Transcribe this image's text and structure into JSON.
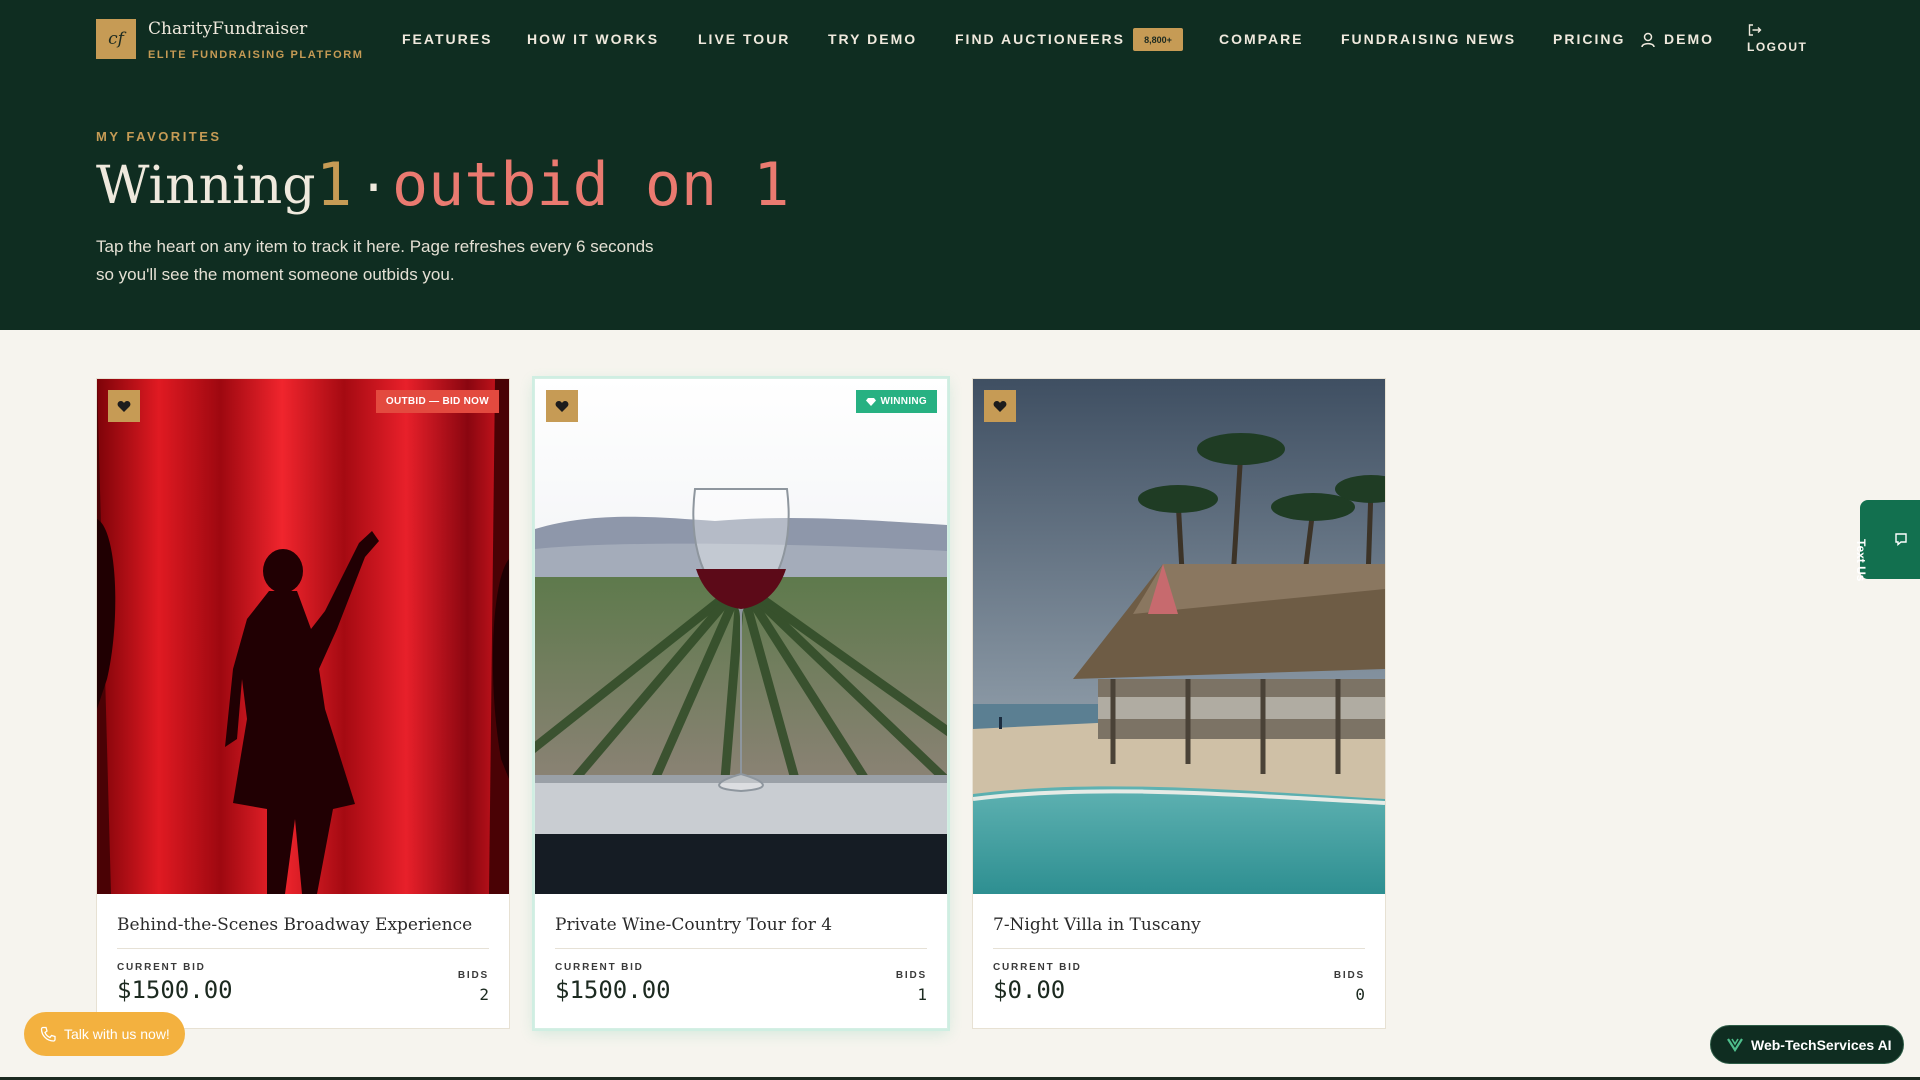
{
  "brand": {
    "logo_mark": "cf",
    "name": "CharityFundraiser",
    "tagline": "ELITE FUNDRAISING PLATFORM"
  },
  "nav": {
    "items": [
      {
        "label": "FEATURES"
      },
      {
        "label": "HOW IT WORKS"
      },
      {
        "label": "LIVE TOUR"
      },
      {
        "label": "TRY DEMO"
      },
      {
        "label": "FIND AUCTIONEERS",
        "badge": "8,800+"
      },
      {
        "label": "COMPARE"
      },
      {
        "label": "FUNDRAISING NEWS"
      },
      {
        "label": "PRICING"
      }
    ],
    "user_label": "DEMO",
    "logout_label": "LOGOUT"
  },
  "hero": {
    "eyebrow": "MY FAVORITES",
    "winning_label": "Winning",
    "winning_count": "1",
    "separator": "·",
    "outbid_text": "outbid on 1",
    "description": "Tap the heart on any item to track it here. Page refreshes every 6 seconds so you'll see the moment someone outbids you."
  },
  "cards": [
    {
      "title": "Behind-the-Scenes Broadway Experience",
      "status": "OUTBID — BID NOW",
      "current_bid_label": "CURRENT BID",
      "current_bid": "$1500.00",
      "bids_label": "BIDS",
      "bids": "2"
    },
    {
      "title": "Private Wine-Country Tour for 4",
      "status": "WINNING",
      "current_bid_label": "CURRENT BID",
      "current_bid": "$1500.00",
      "bids_label": "BIDS",
      "bids": "1"
    },
    {
      "title": "7-Night Villa in Tuscany",
      "status": "",
      "current_bid_label": "CURRENT BID",
      "current_bid": "$0.00",
      "bids_label": "BIDS",
      "bids": "0"
    }
  ],
  "widgets": {
    "text_us": "Text Us",
    "talk": "Talk with us now!",
    "web_tech": "Web-TechServices AI"
  },
  "colors": {
    "header_bg": "#0f2d21",
    "gold": "#c69b55",
    "outbid_red": "#e34a3f",
    "winning_green": "#27b182",
    "page_bg": "#f6f4ee"
  }
}
